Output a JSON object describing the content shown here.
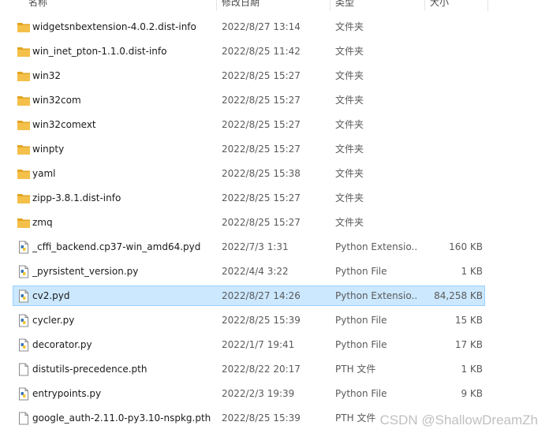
{
  "header": {
    "name": "名称",
    "date": "修改日期",
    "type": "类型",
    "size": "大小"
  },
  "icons": {
    "folder": "folder-icon",
    "python": "python-file-icon",
    "file": "blank-file-icon"
  },
  "colors": {
    "folder": "#f4c04a",
    "selection": "#cce8ff",
    "selection_border": "#99d1ff"
  },
  "files": [
    {
      "name": "widgetsnbextension-4.0.2.dist-info",
      "date": "2022/8/27 13:14",
      "type": "文件夹",
      "size": "",
      "icon": "folder"
    },
    {
      "name": "win_inet_pton-1.1.0.dist-info",
      "date": "2022/8/25 11:42",
      "type": "文件夹",
      "size": "",
      "icon": "folder"
    },
    {
      "name": "win32",
      "date": "2022/8/25 15:27",
      "type": "文件夹",
      "size": "",
      "icon": "folder"
    },
    {
      "name": "win32com",
      "date": "2022/8/25 15:27",
      "type": "文件夹",
      "size": "",
      "icon": "folder"
    },
    {
      "name": "win32comext",
      "date": "2022/8/25 15:27",
      "type": "文件夹",
      "size": "",
      "icon": "folder"
    },
    {
      "name": "winpty",
      "date": "2022/8/25 15:27",
      "type": "文件夹",
      "size": "",
      "icon": "folder"
    },
    {
      "name": "yaml",
      "date": "2022/8/25 15:38",
      "type": "文件夹",
      "size": "",
      "icon": "folder"
    },
    {
      "name": "zipp-3.8.1.dist-info",
      "date": "2022/8/25 15:27",
      "type": "文件夹",
      "size": "",
      "icon": "folder"
    },
    {
      "name": "zmq",
      "date": "2022/8/25 15:27",
      "type": "文件夹",
      "size": "",
      "icon": "folder"
    },
    {
      "name": "_cffi_backend.cp37-win_amd64.pyd",
      "date": "2022/7/3 1:31",
      "type": "Python Extensio...",
      "size": "160 KB",
      "icon": "python"
    },
    {
      "name": "_pyrsistent_version.py",
      "date": "2022/4/4 3:22",
      "type": "Python File",
      "size": "1 KB",
      "icon": "python"
    },
    {
      "name": "cv2.pyd",
      "date": "2022/8/27 14:26",
      "type": "Python Extensio...",
      "size": "84,258 KB",
      "icon": "python",
      "selected": true
    },
    {
      "name": "cycler.py",
      "date": "2022/8/25 15:39",
      "type": "Python File",
      "size": "15 KB",
      "icon": "python"
    },
    {
      "name": "decorator.py",
      "date": "2022/1/7 19:41",
      "type": "Python File",
      "size": "17 KB",
      "icon": "python"
    },
    {
      "name": "distutils-precedence.pth",
      "date": "2022/8/22 20:17",
      "type": "PTH 文件",
      "size": "1 KB",
      "icon": "file"
    },
    {
      "name": "entrypoints.py",
      "date": "2022/2/3 19:39",
      "type": "Python File",
      "size": "9 KB",
      "icon": "python"
    },
    {
      "name": "google_auth-2.11.0-py3.10-nspkg.pth",
      "date": "2022/8/25 15:39",
      "type": "PTH 文件",
      "size": "",
      "icon": "file"
    }
  ],
  "watermark": "CSDN @ShallowDreamZh"
}
